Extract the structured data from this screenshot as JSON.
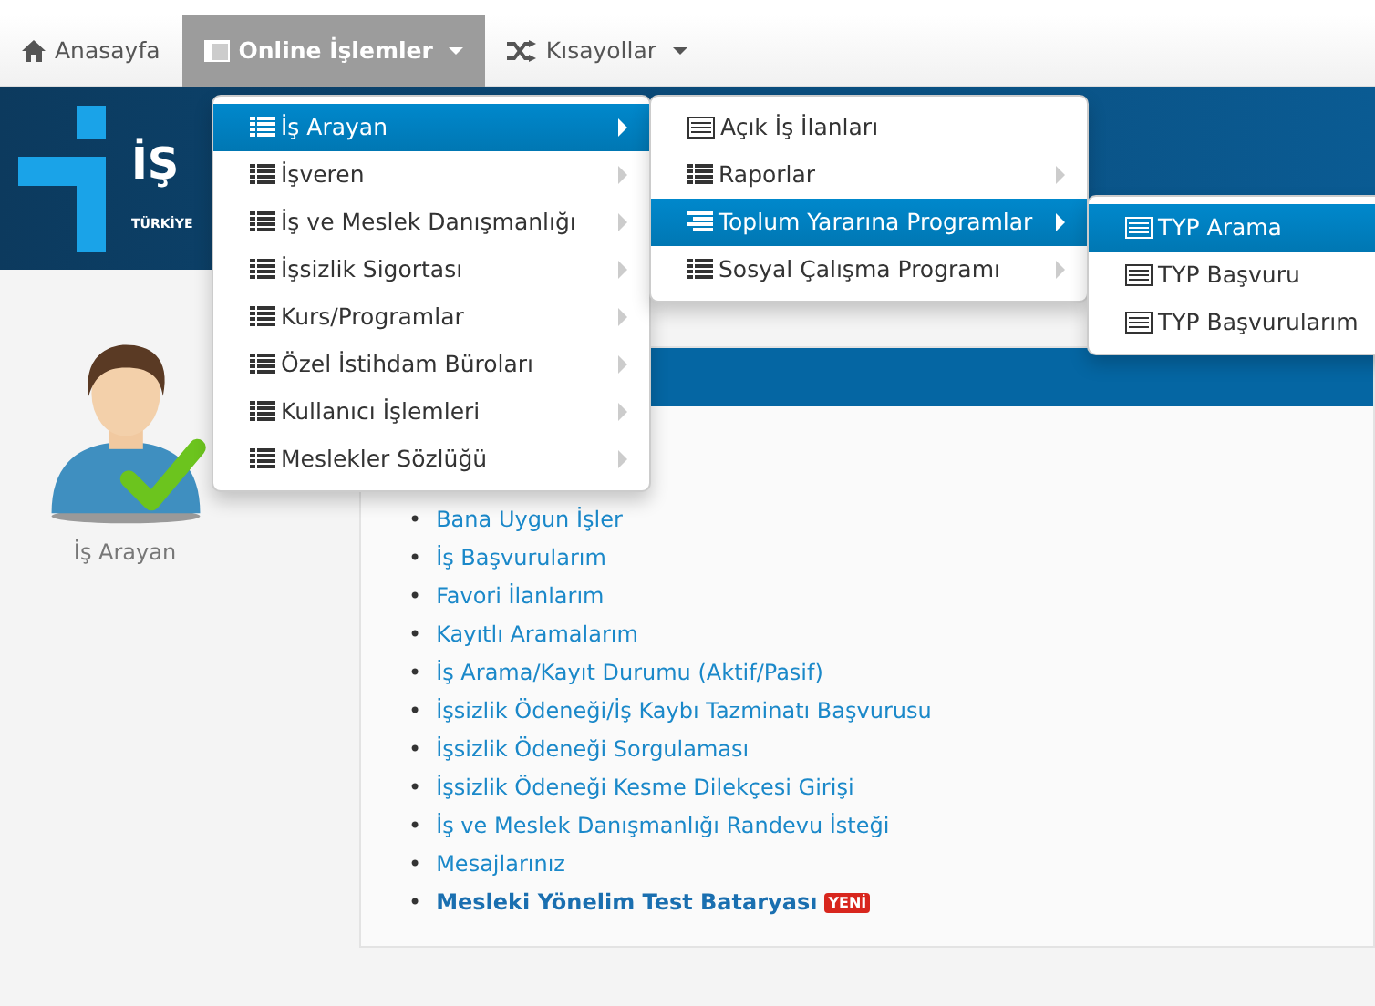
{
  "navbar": {
    "items": [
      {
        "label": "Anasayfa",
        "kind": "home",
        "caret": false,
        "selected": false
      },
      {
        "label": "Online İşlemler",
        "kind": "window",
        "caret": true,
        "selected": true
      },
      {
        "label": "Kısayollar",
        "kind": "shuffle",
        "caret": true,
        "selected": false
      }
    ]
  },
  "banner": {
    "logo_text": "İŞ",
    "logo_subtitle": "TÜRKİYE"
  },
  "profile": {
    "label": "İş Arayan"
  },
  "links": [
    {
      "marker": "•",
      "label": "Bana Uygun İşler",
      "bold": false
    },
    {
      "marker": "•",
      "label": "İş Başvurularım",
      "bold": false
    },
    {
      "marker": "•",
      "label": "Favori İlanlarım",
      "bold": false
    },
    {
      "marker": "•",
      "label": "Kayıtlı Aramalarım",
      "bold": false
    },
    {
      "marker": "•",
      "label": "İş Arama/Kayıt Durumu (Aktif/Pasif)",
      "bold": false
    },
    {
      "marker": "•",
      "label": "İşsizlik Ödeneği/İş Kaybı Tazminatı Başvurusu",
      "bold": false
    },
    {
      "marker": "•",
      "label": "İşsizlik Ödeneği Sorgulaması",
      "bold": false
    },
    {
      "marker": "•",
      "label": "İşsizlik Ödeneği Kesme Dilekçesi Girişi",
      "bold": false
    },
    {
      "marker": "•",
      "label": "İş ve Meslek Danışmanlığı Randevu İsteği",
      "bold": false
    },
    {
      "marker": "•",
      "label": "Mesajlarınız",
      "bold": false
    },
    {
      "marker": "•",
      "label": "Mesleki Yönelim Test Bataryası",
      "bold": true,
      "badge": "YENİ"
    }
  ],
  "menus": [
    {
      "items": [
        {
          "label": "İş Arayan",
          "kind": "list",
          "submenu": true,
          "selected": true
        },
        {
          "label": "İşveren",
          "kind": "list",
          "submenu": true,
          "selected": false
        },
        {
          "label": "İş ve Meslek Danışmanlığı",
          "kind": "list",
          "submenu": true,
          "selected": false
        },
        {
          "label": "İşsizlik Sigortası",
          "kind": "list",
          "submenu": true,
          "selected": false
        },
        {
          "label": "Kurs/Programlar",
          "kind": "list",
          "submenu": true,
          "selected": false
        },
        {
          "label": "Özel İstihdam Büroları",
          "kind": "list",
          "submenu": true,
          "selected": false
        },
        {
          "label": "Kullanıcı İşlemleri",
          "kind": "list",
          "submenu": true,
          "selected": false
        },
        {
          "label": "Meslekler Sözlüğü",
          "kind": "list",
          "submenu": true,
          "selected": false
        }
      ]
    },
    {
      "items": [
        {
          "label": "Açık İş İlanları",
          "kind": "card",
          "submenu": false,
          "selected": false
        },
        {
          "label": "Raporlar",
          "kind": "list",
          "submenu": true,
          "selected": false
        },
        {
          "label": "Toplum Yararına Programlar",
          "kind": "outline",
          "submenu": true,
          "selected": true
        },
        {
          "label": "Sosyal Çalışma Programı",
          "kind": "list",
          "submenu": true,
          "selected": false
        }
      ]
    },
    {
      "items": [
        {
          "label": "TYP Arama",
          "kind": "card",
          "submenu": false,
          "selected": true
        },
        {
          "label": "TYP Başvuru",
          "kind": "card",
          "submenu": false,
          "selected": false
        },
        {
          "label": "TYP Başvurularım",
          "kind": "card",
          "submenu": false,
          "selected": false
        }
      ]
    }
  ]
}
